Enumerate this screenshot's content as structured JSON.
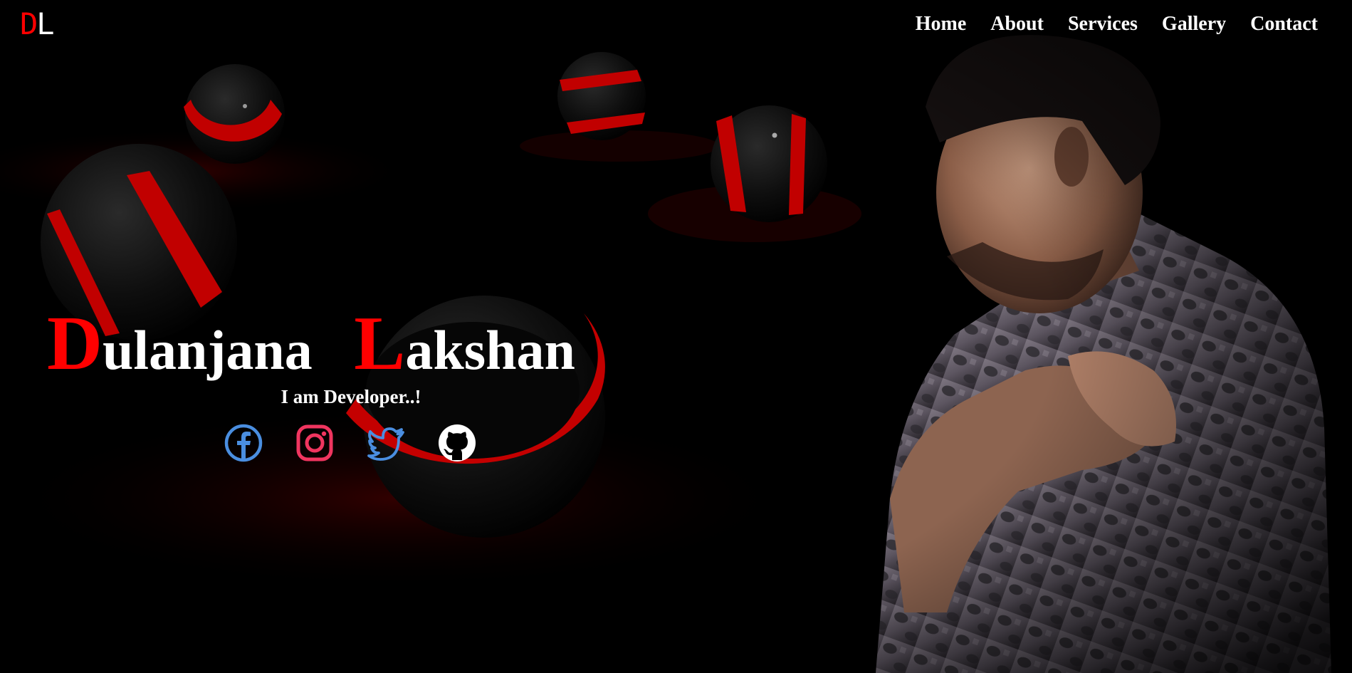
{
  "logo": {
    "letter_1": "D",
    "letter_2": "L"
  },
  "nav": {
    "items": [
      {
        "label": "Home"
      },
      {
        "label": "About"
      },
      {
        "label": "Services"
      },
      {
        "label": "Gallery"
      },
      {
        "label": "Contact"
      }
    ]
  },
  "hero": {
    "first_initial": "D",
    "first_rest": "ulanjana",
    "last_initial": "L",
    "last_rest": "akshan",
    "subtitle": "I am Developer..!"
  },
  "social": [
    {
      "icon": "facebook-icon",
      "color": "#4a8ee0"
    },
    {
      "icon": "instagram-icon",
      "color": "#f0355f"
    },
    {
      "icon": "twitter-icon",
      "color": "#4a8ee0"
    },
    {
      "icon": "github-icon",
      "color": "#ffffff"
    }
  ],
  "colors": {
    "accent": "#ff0000",
    "text": "#ffffff",
    "background": "#000000"
  }
}
